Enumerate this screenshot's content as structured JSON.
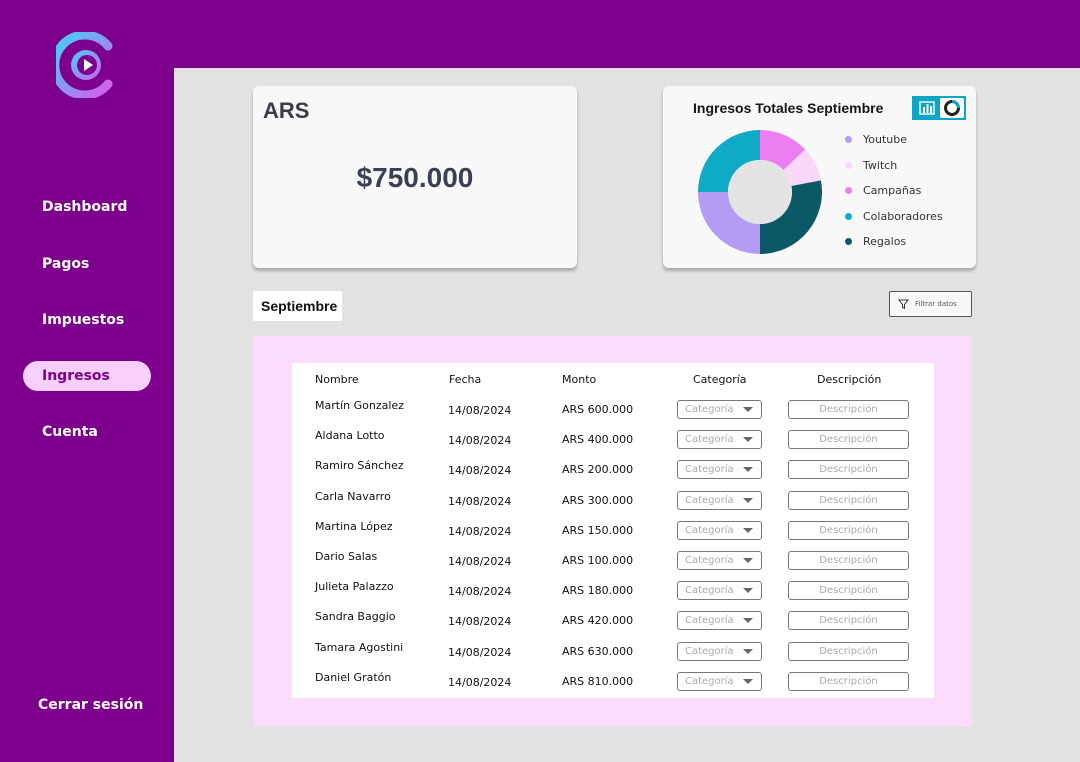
{
  "sidebar": {
    "items": [
      {
        "label": "Dashboard",
        "active": false
      },
      {
        "label": "Pagos",
        "active": false
      },
      {
        "label": "Impuestos",
        "active": false
      },
      {
        "label": "Ingresos",
        "active": true
      },
      {
        "label": "Cuenta",
        "active": false
      }
    ],
    "logout_label": "Cerrar sesión"
  },
  "balance": {
    "currency": "ARS",
    "amount": "$750.000"
  },
  "chart": {
    "title": "Ingresos Totales Septiembre",
    "toggle_icons": [
      "bar-chart-icon",
      "pie-chart-icon"
    ]
  },
  "chart_data": {
    "type": "pie",
    "title": "Ingresos Totales Septiembre",
    "style": "donut",
    "legend_position": "right",
    "series": [
      {
        "name": "Youtube",
        "value": 25,
        "color": "#b49bf3"
      },
      {
        "name": "Twitch",
        "value": 9,
        "color": "#fad7fb"
      },
      {
        "name": "Campañas",
        "value": 13,
        "color": "#ec7ef2"
      },
      {
        "name": "Colaboradores",
        "value": 25,
        "color": "#10aac9"
      },
      {
        "name": "Regalos",
        "value": 28,
        "color": "#0b5966"
      }
    ]
  },
  "table_section": {
    "month_label": "Septiembre",
    "filter_label": "Filtrar datos",
    "headers": [
      "Nombre",
      "Fecha",
      "Monto",
      "Categoría",
      "Descripción"
    ],
    "category_placeholder": "Categoría",
    "description_placeholder": "Descripción",
    "rows": [
      {
        "name": "Martín Gonzalez",
        "date": "14/08/2024",
        "amount": "ARS 600.000"
      },
      {
        "name": "Aldana Lotto",
        "date": "14/08/2024",
        "amount": "ARS 400.000"
      },
      {
        "name": "Ramiro Sánchez",
        "date": "14/08/2024",
        "amount": "ARS 200.000"
      },
      {
        "name": "Carla Navarro",
        "date": "14/08/2024",
        "amount": "ARS 300.000"
      },
      {
        "name": "Martina López",
        "date": "14/08/2024",
        "amount": "ARS 150.000"
      },
      {
        "name": "Dario Salas",
        "date": "14/08/2024",
        "amount": "ARS 100.000"
      },
      {
        "name": "Julieta Palazzo",
        "date": "14/08/2024",
        "amount": "ARS 180.000"
      },
      {
        "name": "Sandra Baggio",
        "date": "14/08/2024",
        "amount": "ARS 420.000"
      },
      {
        "name": "Tamara Agostini",
        "date": "14/08/2024",
        "amount": "ARS 630.000"
      },
      {
        "name": "Daniel Gratón",
        "date": "14/08/2024",
        "amount": "ARS 810.000"
      }
    ]
  },
  "colors": {
    "brand_purple": "#7d008c",
    "active_pill": "#f6d0fb",
    "table_panel": "#fbdcfd",
    "accent_cyan": "#0fa5c5"
  }
}
